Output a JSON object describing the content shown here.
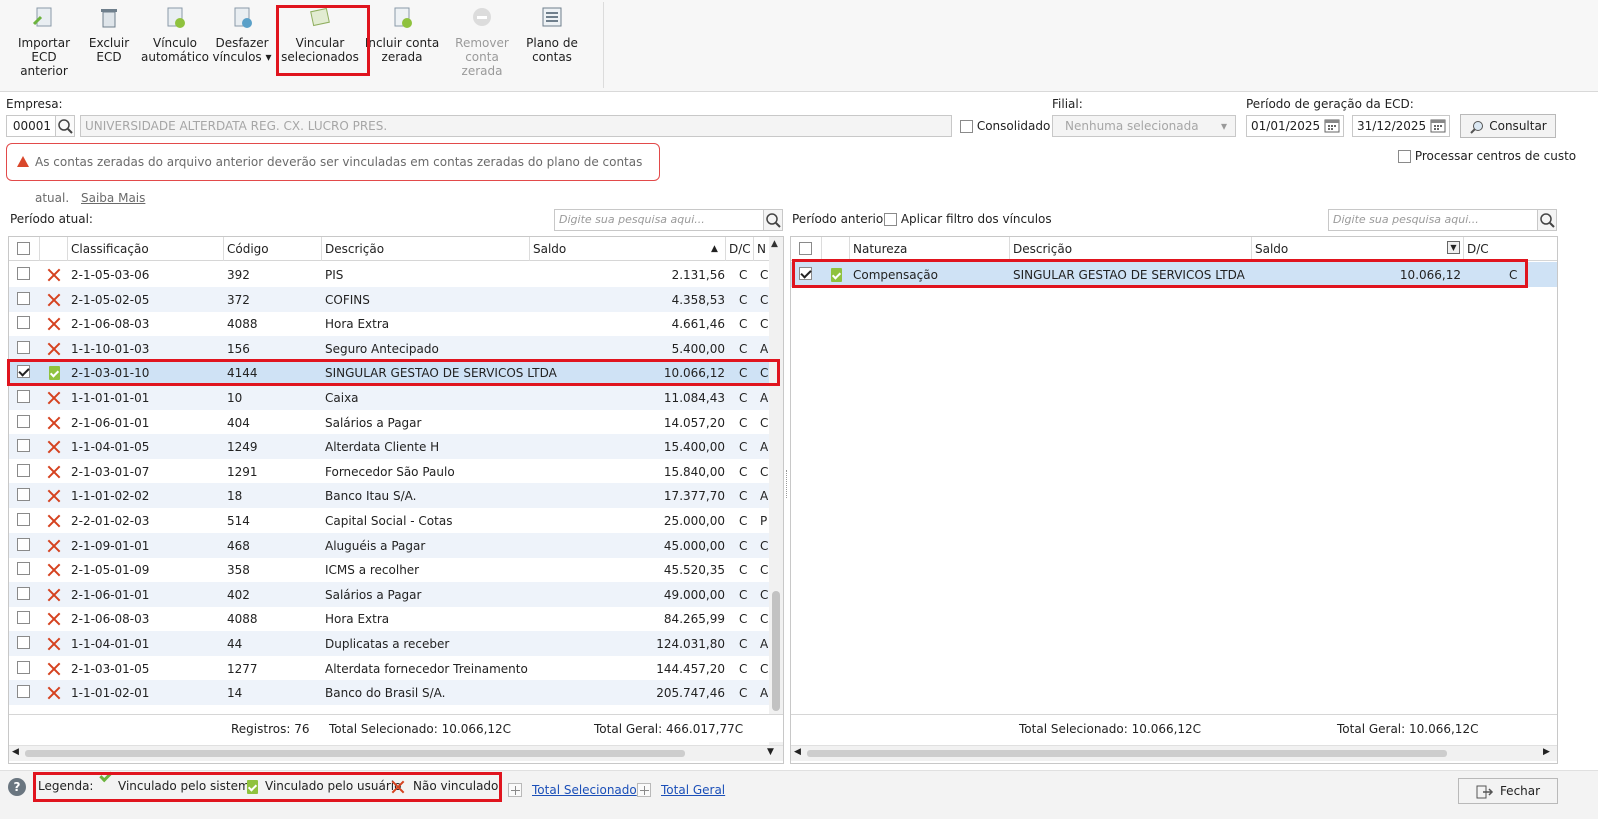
{
  "toolbar": {
    "buttons": [
      {
        "label": "Importar\nECD anterior",
        "disabled": false
      },
      {
        "label": "Excluir\nECD",
        "disabled": false
      },
      {
        "label": "Vínculo\nautomático",
        "disabled": false
      },
      {
        "label": "Desfazer\nvínculos ▾",
        "disabled": false
      },
      {
        "label": "Vincular\nselecionados",
        "disabled": false
      },
      {
        "label": "Incluir conta\nzerada",
        "disabled": false
      },
      {
        "label": "Remover\nconta zerada",
        "disabled": true
      },
      {
        "label": "Plano de\ncontas",
        "disabled": false
      }
    ]
  },
  "form": {
    "empresa_label": "Empresa:",
    "empresa_code": "00001",
    "empresa_name": "UNIVERSIDADE ALTERDATA REG. CX. LUCRO PRES.",
    "consolidado_label": "Consolidado",
    "filial_label": "Filial:",
    "filial_value": "Nenhuma selecionada",
    "periodo_label": "Período de geração da ECD:",
    "data_inicio": "01/01/2025",
    "data_fim": "31/12/2025",
    "consultar_label": "Consultar",
    "processar_label": "Processar centros de custo"
  },
  "alert": {
    "message": "As contas zeradas do arquivo anterior deverão ser vinculadas em contas zeradas do plano de contas atual.",
    "link": "Saiba Mais"
  },
  "left": {
    "label": "Período atual:",
    "search_placeholder": "Digite sua pesquisa aqui...",
    "headers": [
      "Classificação",
      "Código",
      "Descrição",
      "Saldo",
      "D/C",
      "N"
    ],
    "rows": [
      {
        "cls": "2-1-05-03-06",
        "cod": "392",
        "desc": "PIS",
        "saldo": "2.131,56",
        "dc": "C",
        "n": "C",
        "status": "x",
        "checked": false
      },
      {
        "cls": "2-1-05-02-05",
        "cod": "372",
        "desc": "COFINS",
        "saldo": "4.358,53",
        "dc": "C",
        "n": "C",
        "status": "x",
        "checked": false
      },
      {
        "cls": "2-1-06-08-03",
        "cod": "4088",
        "desc": "Hora Extra",
        "saldo": "4.661,46",
        "dc": "C",
        "n": "C",
        "status": "x",
        "checked": false
      },
      {
        "cls": "1-1-10-01-03",
        "cod": "156",
        "desc": "Seguro Antecipado",
        "saldo": "5.400,00",
        "dc": "C",
        "n": "A",
        "status": "x",
        "checked": false
      },
      {
        "cls": "2-1-03-01-10",
        "cod": "4144",
        "desc": "SINGULAR GESTAO DE SERVICOS LTDA",
        "saldo": "10.066,12",
        "dc": "C",
        "n": "C",
        "status": "user",
        "checked": true
      },
      {
        "cls": "1-1-01-01-01",
        "cod": "10",
        "desc": "Caixa",
        "saldo": "11.084,43",
        "dc": "C",
        "n": "A",
        "status": "x",
        "checked": false
      },
      {
        "cls": "2-1-06-01-01",
        "cod": "404",
        "desc": "Salários a Pagar",
        "saldo": "14.057,20",
        "dc": "C",
        "n": "C",
        "status": "x",
        "checked": false
      },
      {
        "cls": "1-1-04-01-05",
        "cod": "1249",
        "desc": "Alterdata Cliente H",
        "saldo": "15.400,00",
        "dc": "C",
        "n": "A",
        "status": "x",
        "checked": false
      },
      {
        "cls": "2-1-03-01-07",
        "cod": "1291",
        "desc": "Fornecedor São Paulo",
        "saldo": "15.840,00",
        "dc": "C",
        "n": "C",
        "status": "x",
        "checked": false
      },
      {
        "cls": "1-1-01-02-02",
        "cod": "18",
        "desc": "Banco Itau S/A.",
        "saldo": "17.377,70",
        "dc": "C",
        "n": "A",
        "status": "x",
        "checked": false
      },
      {
        "cls": "2-2-01-02-03",
        "cod": "514",
        "desc": "Capital Social - Cotas",
        "saldo": "25.000,00",
        "dc": "C",
        "n": "P",
        "status": "x",
        "checked": false
      },
      {
        "cls": "2-1-09-01-01",
        "cod": "468",
        "desc": "Aluguéis a Pagar",
        "saldo": "45.000,00",
        "dc": "C",
        "n": "C",
        "status": "x",
        "checked": false
      },
      {
        "cls": "2-1-05-01-09",
        "cod": "358",
        "desc": "ICMS a recolher",
        "saldo": "45.520,35",
        "dc": "C",
        "n": "C",
        "status": "x",
        "checked": false
      },
      {
        "cls": "2-1-06-01-01",
        "cod": "402",
        "desc": "Salários a Pagar",
        "saldo": "49.000,00",
        "dc": "C",
        "n": "C",
        "status": "x",
        "checked": false
      },
      {
        "cls": "2-1-06-08-03",
        "cod": "4088",
        "desc": "Hora Extra",
        "saldo": "84.265,99",
        "dc": "C",
        "n": "C",
        "status": "x",
        "checked": false
      },
      {
        "cls": "1-1-04-01-01",
        "cod": "44",
        "desc": "Duplicatas a receber",
        "saldo": "124.031,80",
        "dc": "C",
        "n": "A",
        "status": "x",
        "checked": false
      },
      {
        "cls": "2-1-03-01-05",
        "cod": "1277",
        "desc": "Alterdata fornecedor Treinamento",
        "saldo": "144.457,20",
        "dc": "C",
        "n": "C",
        "status": "x",
        "checked": false
      },
      {
        "cls": "1-1-01-02-01",
        "cod": "14",
        "desc": "Banco do Brasil S/A.",
        "saldo": "205.747,46",
        "dc": "C",
        "n": "A",
        "status": "x",
        "checked": false
      }
    ],
    "footer": {
      "registros": "Registros: 76",
      "total_sel": "Total Selecionado: 10.066,12C",
      "total_geral": "Total Geral: 466.017,77C"
    }
  },
  "right": {
    "label": "Período anterior:",
    "filter_label": "Aplicar filtro dos vínculos",
    "search_placeholder": "Digite sua pesquisa aqui...",
    "headers": [
      "Natureza",
      "Descrição",
      "Saldo",
      "D/C"
    ],
    "rows": [
      {
        "nat": "Compensação",
        "desc": "SINGULAR GESTAO DE SERVICOS LTDA",
        "saldo": "10.066,12",
        "dc": "C",
        "checked": true
      }
    ],
    "footer": {
      "total_sel": "Total Selecionado: 10.066,12C",
      "total_geral": "Total Geral: 10.066,12C"
    }
  },
  "legend": {
    "title": "Legenda:",
    "sistema": "Vinculado pelo sistema",
    "usuario": "Vinculado pelo usuário",
    "nao": "Não vinculado"
  },
  "links": {
    "total_sel": "Total Selecionado",
    "total_geral": "Total Geral"
  },
  "fechar_label": "Fechar",
  "help_icon": "?"
}
